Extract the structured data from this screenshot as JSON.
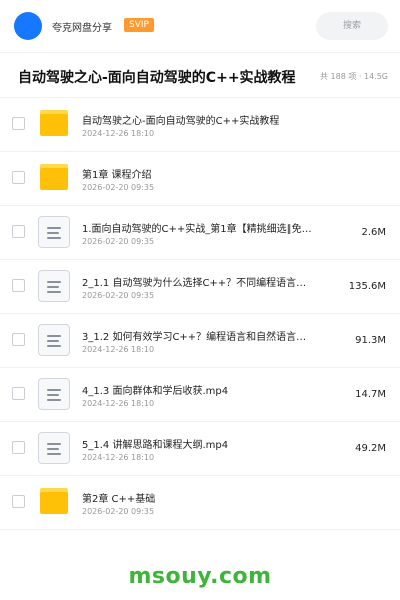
{
  "header": {
    "brand": "夸克网盘分享",
    "badge": "SVIP",
    "search_label": "搜索"
  },
  "titlebar": {
    "title": "自动驾驶之心-面向自动驾驶的C++实战教程",
    "summary": "共 188 项 · 14.5G"
  },
  "files": [
    {
      "type": "folder",
      "name": "自动驾驶之心-面向自动驾驶的C++实战教程",
      "date": "2024-12-26 18:10",
      "size": ""
    },
    {
      "type": "folder",
      "name": "第1章 课程介绍",
      "date": "2026-02-20 09:35",
      "size": ""
    },
    {
      "type": "file",
      "name": "1.面向自动驾驶的C++实战_第1章【精挑细选∥免…",
      "date": "2026-02-20 09:35",
      "size": "2.6M"
    },
    {
      "type": "file",
      "name": "2_1.1 自动驾驶为什么选择C++？不同编程语言…",
      "date": "2026-02-20 09:35",
      "size": "135.6M"
    },
    {
      "type": "file",
      "name": "3_1.2 如何有效学习C++？编程语言和自然语言…",
      "date": "2024-12-26 18:10",
      "size": "91.3M"
    },
    {
      "type": "file",
      "name": "4_1.3 面向群体和学后收获.mp4",
      "date": "2024-12-26 18:10",
      "size": "14.7M"
    },
    {
      "type": "file",
      "name": "5_1.4 讲解思路和课程大纲.mp4",
      "date": "2024-12-26 18:10",
      "size": "49.2M"
    },
    {
      "type": "folder",
      "name": "第2章 C++基础",
      "date": "2026-02-20 09:35",
      "size": ""
    }
  ],
  "watermark": "msouy.com",
  "colors": {
    "accent": "#1677ff",
    "svip": "#ff9a2e",
    "folder": "#ffc107",
    "watermark": "#3fb43a"
  }
}
